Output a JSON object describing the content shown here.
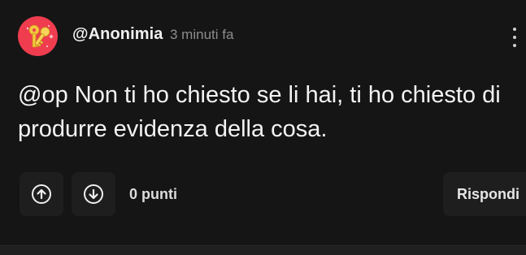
{
  "post": {
    "avatar_icon": "keys-icon",
    "avatar_color": "#ef3d4f",
    "username": "@Anonimia",
    "timestamp": "3 minuti fa",
    "text": "@op Non ti ho chiesto se li hai, ti ho chiesto di produrre evidenza della cosa.",
    "points": "0 punti",
    "reply_label": "Rispondi"
  },
  "icons": {
    "upvote": "arrow-up-circle-icon",
    "downvote": "arrow-down-circle-icon",
    "more": "more-vertical-icon"
  }
}
